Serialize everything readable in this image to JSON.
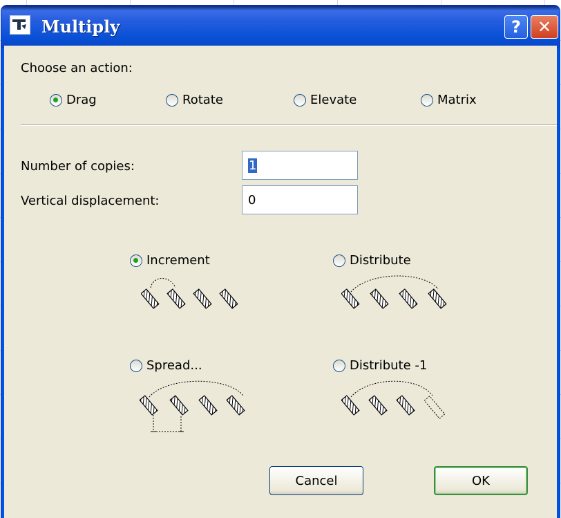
{
  "window": {
    "title": "Multiply",
    "help_label": "?",
    "close_label": "✕"
  },
  "action": {
    "prompt": "Choose an action:",
    "options": [
      {
        "label": "Drag",
        "selected": true
      },
      {
        "label": "Rotate",
        "selected": false
      },
      {
        "label": "Elevate",
        "selected": false
      },
      {
        "label": "Matrix",
        "selected": false
      }
    ]
  },
  "fields": {
    "copies_label": "Number of copies:",
    "copies_value": "1",
    "vertical_label": "Vertical displacement:",
    "vertical_value": "0"
  },
  "modes": [
    {
      "label": "Increment",
      "selected": true,
      "icon": "increment-diagram-icon"
    },
    {
      "label": "Distribute",
      "selected": false,
      "icon": "distribute-diagram-icon"
    },
    {
      "label": "Spread...",
      "selected": false,
      "icon": "spread-diagram-icon"
    },
    {
      "label": "Distribute -1",
      "selected": false,
      "icon": "distribute-minus-one-diagram-icon"
    }
  ],
  "buttons": {
    "cancel_label": "Cancel",
    "ok_label": "OK"
  }
}
